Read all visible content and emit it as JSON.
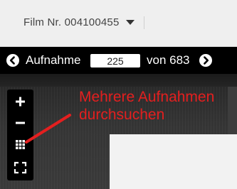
{
  "film_bar": {
    "film_label": "Film Nr. 004100455"
  },
  "nav": {
    "label": "Aufnahme",
    "current_page": "225",
    "of_label": "von 683"
  },
  "toolbar": {
    "items": [
      "plus-icon",
      "minus-icon",
      "grid-icon",
      "fullscreen-icon"
    ]
  },
  "annotation": {
    "line1": "Mehrere Aufnahmen",
    "line2": "durchsuchen",
    "color": "#e41f1f"
  },
  "colors": {
    "nav_background": "#000000",
    "film_bar_background": "#efefef",
    "annotation": "#e41f1f"
  }
}
